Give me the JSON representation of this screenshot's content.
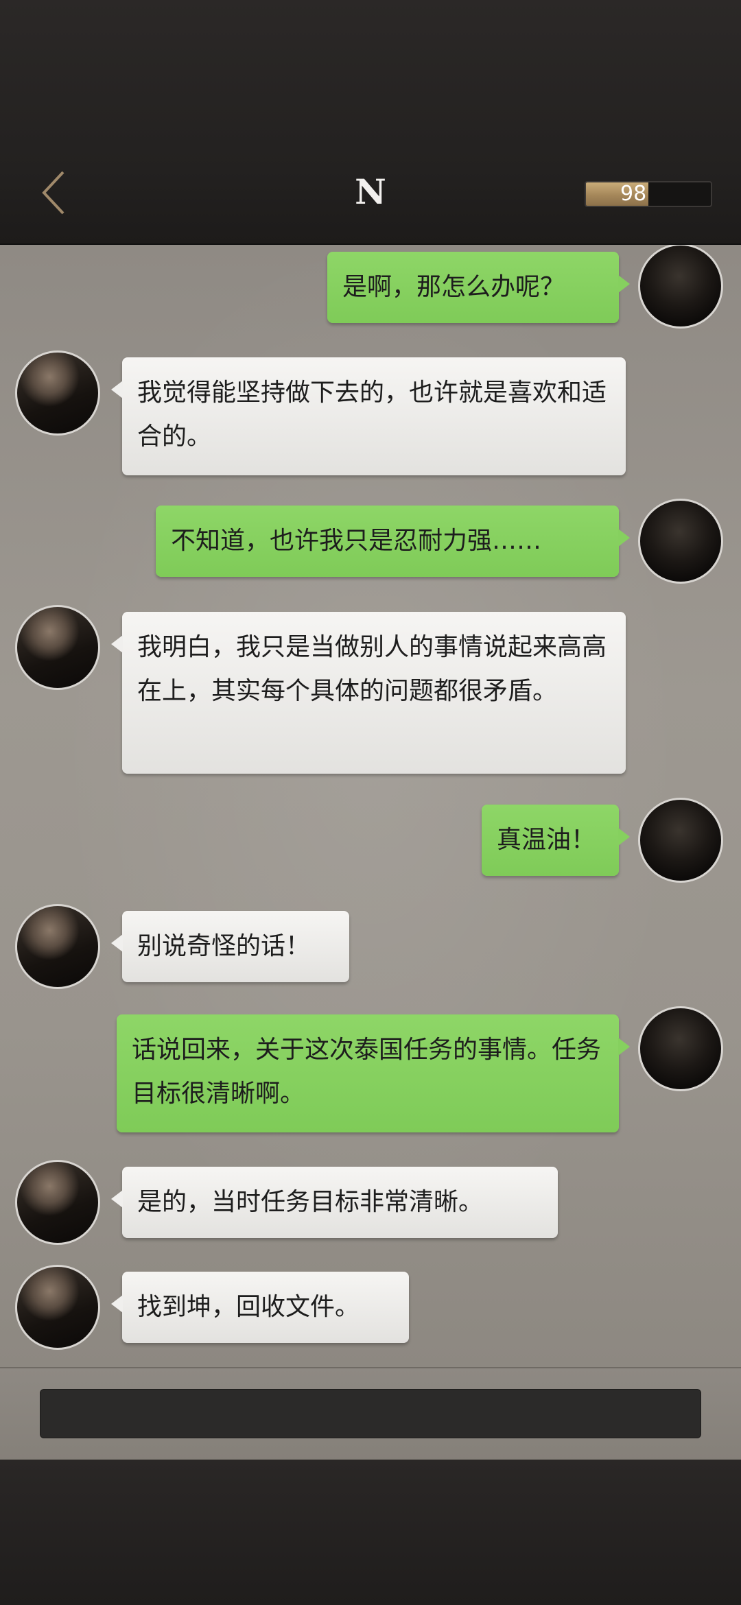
{
  "header": {
    "back_icon": "chevron-left-icon",
    "title": "N",
    "energy_value": "98",
    "energy_fraction": 0.5
  },
  "messages": [
    {
      "from": "me",
      "text": "是啊，那怎么办呢？"
    },
    {
      "from": "other",
      "text": "我觉得能坚持做下去的，也许就是喜欢和适合的。"
    },
    {
      "from": "me",
      "text": "不知道，也许我只是忍耐力强……"
    },
    {
      "from": "other",
      "text": "我明白，我只是当做别人的事情说起来高高在上，其实每个具体的问题都很矛盾。"
    },
    {
      "from": "me",
      "text": "真温油！"
    },
    {
      "from": "other",
      "text": "别说奇怪的话！"
    },
    {
      "from": "me",
      "text": "话说回来，关于这次泰国任务的事情。任务目标很清晰啊。"
    },
    {
      "from": "other",
      "text": "是的，当时任务目标非常清晰。"
    },
    {
      "from": "other",
      "text": "找到坤，回收文件。"
    }
  ],
  "input": {
    "value": ""
  },
  "colors": {
    "me_bubble": "#86d05f",
    "other_bubble": "#f0efed",
    "energy_fill": "#b39463",
    "header_bg": "#262322"
  }
}
